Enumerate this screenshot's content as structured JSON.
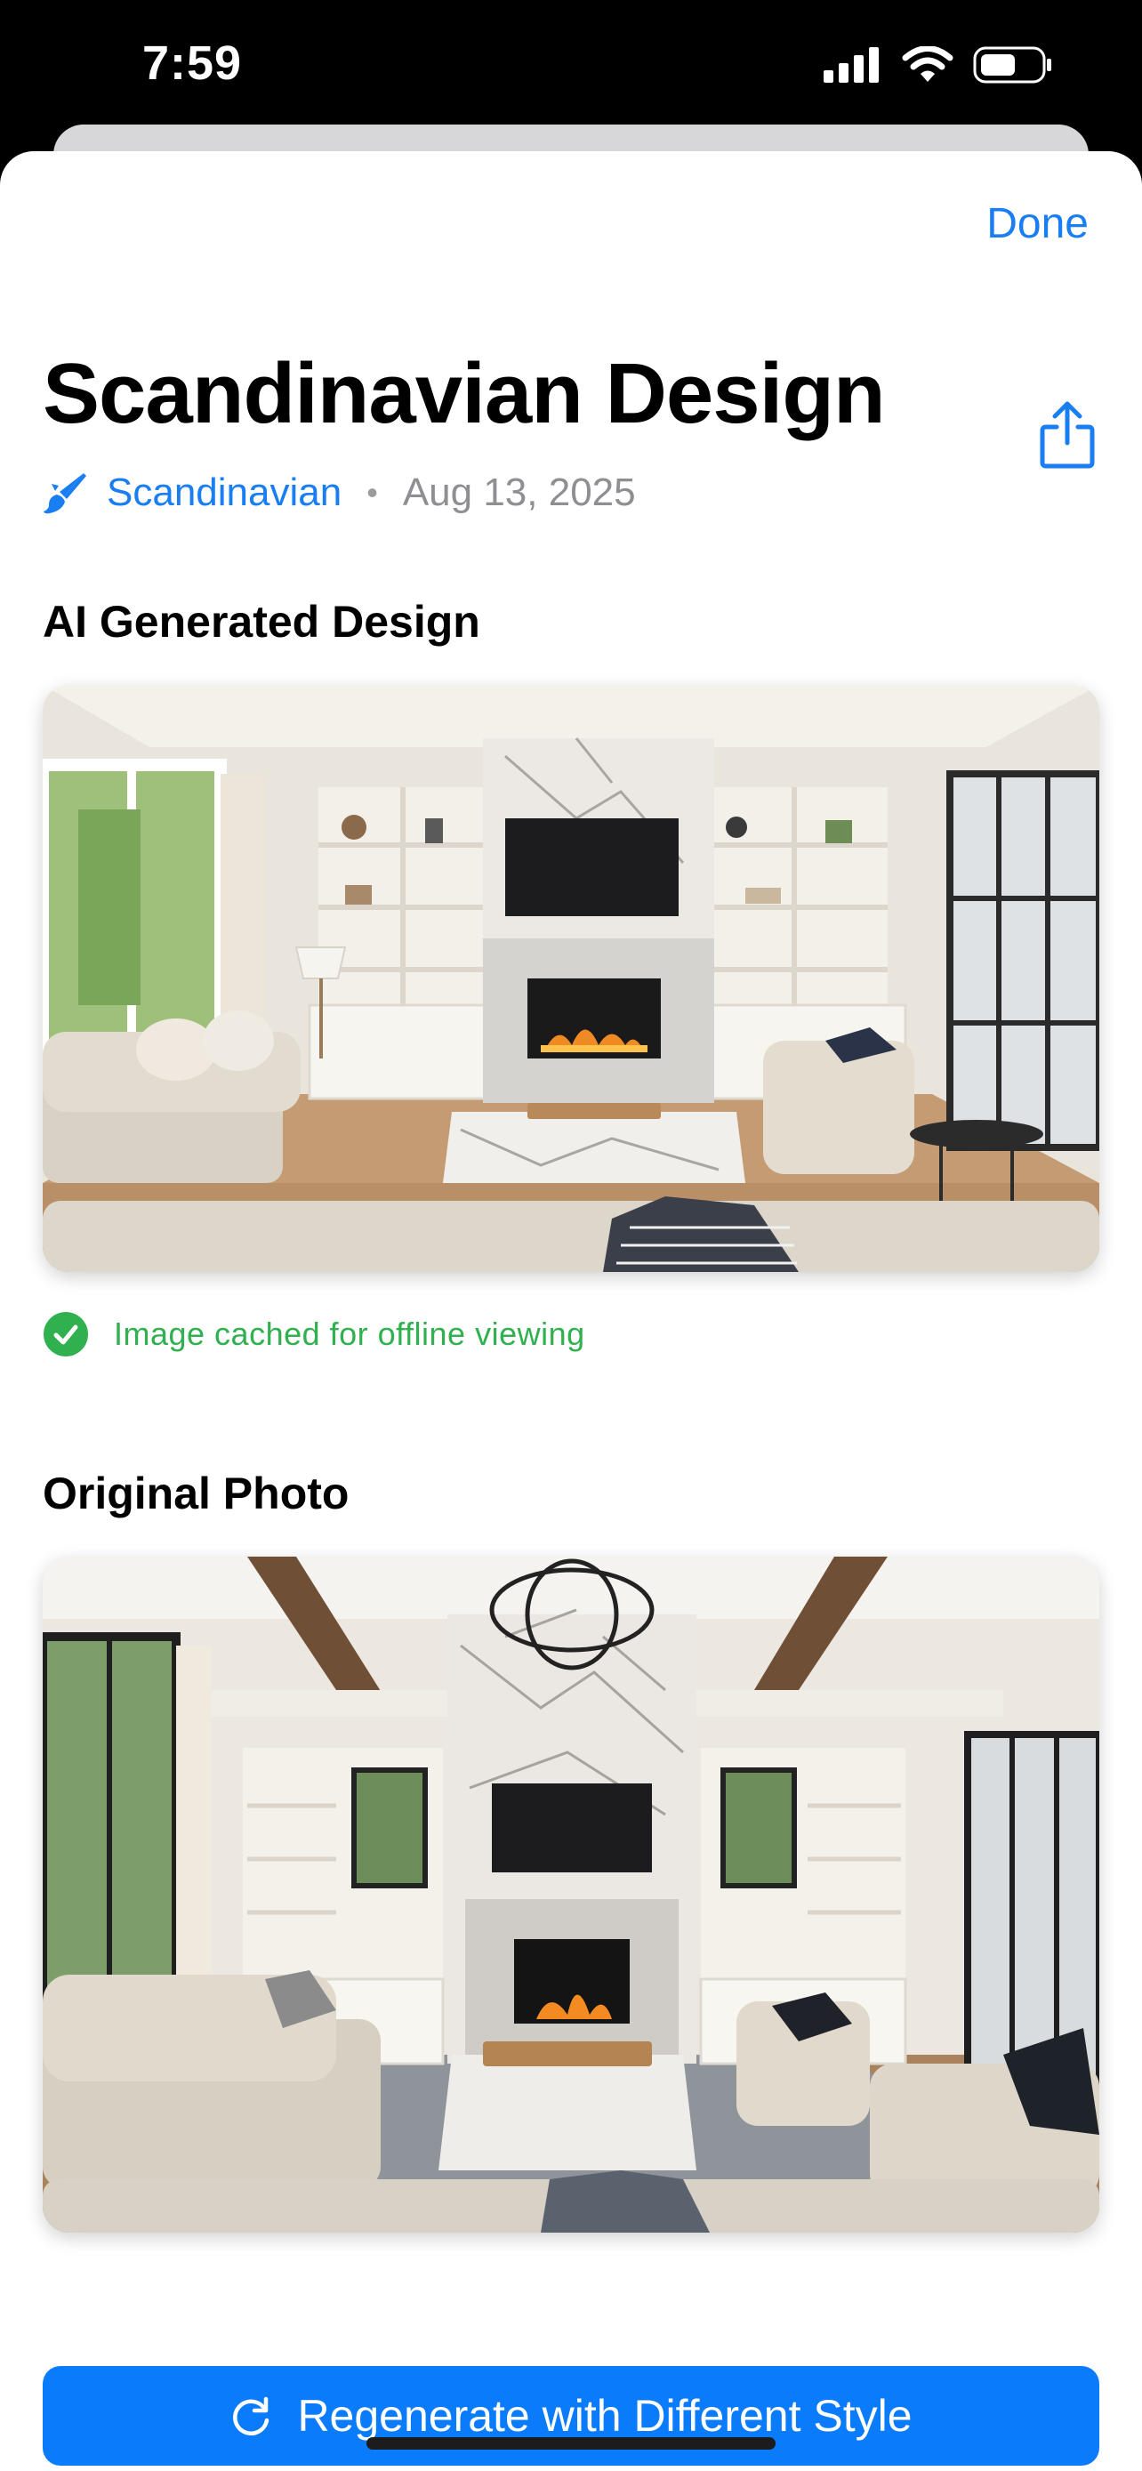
{
  "status_bar": {
    "time": "7:59"
  },
  "header": {
    "done_label": "Done"
  },
  "design": {
    "title": "Scandinavian Design",
    "style_name": "Scandinavian",
    "separator": "•",
    "date": "Aug 13, 2025"
  },
  "sections": {
    "generated_title": "AI Generated Design",
    "cached_status": "Image cached for offline viewing",
    "original_title": "Original Photo"
  },
  "actions": {
    "regenerate_label": "Regenerate with Different Style"
  },
  "colors": {
    "accent": "#1a7ef3",
    "button": "#0a7cfb",
    "success": "#30b04f",
    "secondary_text": "#8e8e93"
  },
  "icons": {
    "share": "share-icon",
    "style": "paintbrush-icon",
    "cached": "checkmark-circle-icon",
    "regenerate": "refresh-icon"
  }
}
